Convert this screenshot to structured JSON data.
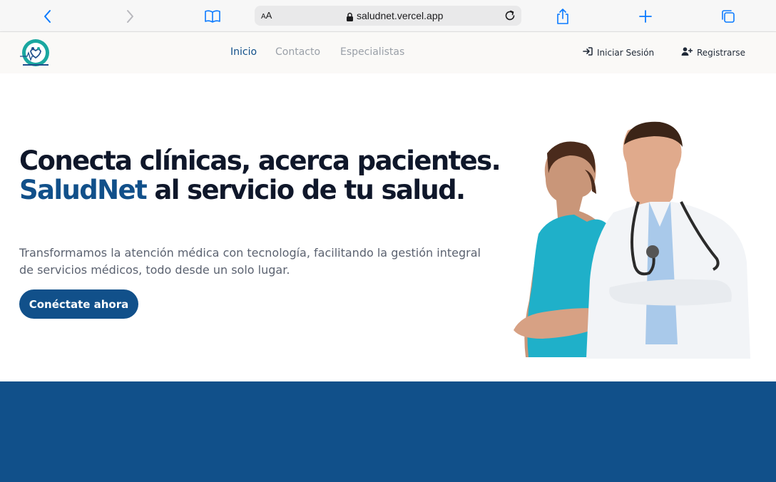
{
  "browser": {
    "url": "saludnet.vercel.app",
    "text_size_label": "AA",
    "icons": [
      "back-icon",
      "forward-icon",
      "bookmarks-icon",
      "lock-icon",
      "reload-icon",
      "share-icon",
      "new-tab-icon",
      "tabs-icon"
    ]
  },
  "navbar": {
    "links": [
      {
        "label": "Inicio",
        "active": true
      },
      {
        "label": "Contacto",
        "active": false
      },
      {
        "label": "Especialistas",
        "active": false
      }
    ],
    "login_label": "Iniciar Sesión",
    "register_label": "Registrarse"
  },
  "hero": {
    "title_part1": "Conecta clínicas, acerca pacientes.",
    "title_brand": "SaludNet",
    "title_part2": "al servicio de tu salud.",
    "subtitle": "Transformamos la atención médica con tecnología, facilitando la gestión integral de servicios médicos, todo desde un solo lugar.",
    "cta_label": "Conéctate ahora",
    "image": "doctor-and-nurse-photo"
  },
  "colors": {
    "primary": "#11508a",
    "heading": "#0f172a",
    "muted": "#9aa0a8",
    "teal": "#1aa7a0",
    "safari_blue": "#0a7aff"
  }
}
